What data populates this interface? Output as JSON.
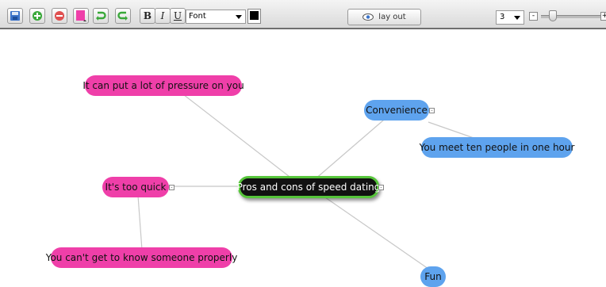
{
  "toolbar": {
    "buttons": [
      {
        "name": "save-icon",
        "color": "#3b73c9"
      },
      {
        "name": "add-node-icon",
        "color": "#3aa83a"
      },
      {
        "name": "remove-node-icon",
        "color": "#e05050"
      },
      {
        "name": "node-color-icon",
        "color": "#ef3fa9"
      },
      {
        "name": "undo-icon",
        "color": "#3aa83a"
      },
      {
        "name": "redo-icon",
        "color": "#3aa83a"
      }
    ],
    "bold_label": "B",
    "italic_label": "I",
    "underline_label": "U",
    "font_value": "Font",
    "text_color": "#000000",
    "layout_label": "lay out",
    "depth_value": "3",
    "zoom_minus": "-",
    "zoom_plus": "+",
    "zoom_level": 0.15
  },
  "mindmap": {
    "central": {
      "label": "Pros and cons of speed dating",
      "fill": "#111111",
      "border": "#56c53a"
    },
    "nodes": [
      {
        "id": "pressure",
        "label": "It can put a lot of pressure on you",
        "color": "#ef3fa9"
      },
      {
        "id": "convenience",
        "label": "Convenience",
        "color": "#5ea3ee"
      },
      {
        "id": "ten-people",
        "label": "You meet ten people in one hour",
        "color": "#5ea3ee"
      },
      {
        "id": "too-quick",
        "label": "It's too quick",
        "color": "#ef3fa9"
      },
      {
        "id": "get-to-know",
        "label": "You can't get to know someone properly",
        "color": "#ef3fa9"
      },
      {
        "id": "fun",
        "label": "Fun",
        "color": "#5ea3ee"
      }
    ]
  }
}
